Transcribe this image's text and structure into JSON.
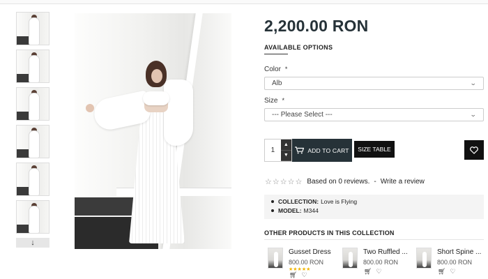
{
  "gallery": {
    "thumbnail_count": 6,
    "scroll_icon": "arrow-down-icon",
    "scroll_glyph": "↓"
  },
  "product": {
    "price": "2,200.00 RON",
    "available_options_title": "AVAILABLE OPTIONS",
    "color": {
      "label": "Color",
      "required_mark": "*",
      "selected": "Alb"
    },
    "size": {
      "label": "Size",
      "required_mark": "*",
      "selected": "--- Please Select ---"
    },
    "quantity": "1",
    "add_to_cart_label": "ADD TO CART",
    "size_table_label": "SIZE TABLE",
    "reviews": {
      "stars_glyph": "☆☆☆☆☆",
      "text": "Based on 0 reviews.",
      "separator": "-",
      "write_review": "Write a review"
    },
    "info": [
      {
        "key": "COLLECTION:",
        "value": "Love is Flying"
      },
      {
        "key": "MODEL:",
        "value": "M344"
      }
    ]
  },
  "collection": {
    "title": "OTHER PRODUCTS IN THIS COLLECTION",
    "products": [
      {
        "name": "Gusset Dress",
        "price": "800.00 RON",
        "stars": "★★★★★"
      },
      {
        "name": "Two Ruffled ...",
        "price": "800.00 RON",
        "stars": ""
      },
      {
        "name": "Short Spine ...",
        "price": "800.00 RON",
        "stars": ""
      }
    ]
  },
  "colors": {
    "dark_button": "#263238",
    "black": "#111111",
    "star_yellow": "#f0b400"
  }
}
